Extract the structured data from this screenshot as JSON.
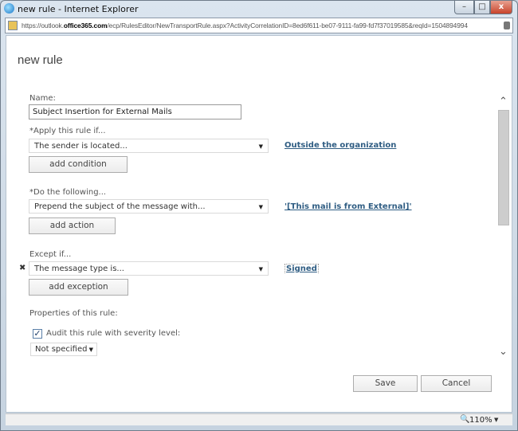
{
  "window": {
    "title": "new rule - Internet Explorer",
    "url_prefix": "https://outlook.",
    "url_domain": "office365.com",
    "url_path": "/ecp/RulesEditor/NewTransportRule.aspx?ActivityCorrelationID=8ed6f611-be07-9111-fa99-fd7f37019585&reqId=1504894994",
    "min": "–",
    "max": "□",
    "close": "x"
  },
  "heading": "new rule",
  "name": {
    "label": "Name:",
    "value": "Subject Insertion for External Mails"
  },
  "apply": {
    "label": "*Apply this rule if...",
    "select": "The sender is located...",
    "link": "Outside the organization",
    "button": "add condition"
  },
  "action": {
    "label": "*Do the following...",
    "select": "Prepend the subject of the message with...",
    "link": "'[This mail is from External]'",
    "button": "add action"
  },
  "except": {
    "label": "Except if...",
    "remove": "✖",
    "select": "The message type is...",
    "link": "Signed",
    "button": "add exception"
  },
  "properties": {
    "label": "Properties of this rule:",
    "audit_label": "Audit this rule with severity level:",
    "audit_checked": true,
    "severity": "Not specified"
  },
  "footer": {
    "save": "Save",
    "cancel": "Cancel"
  },
  "status": {
    "zoom": "110%"
  }
}
